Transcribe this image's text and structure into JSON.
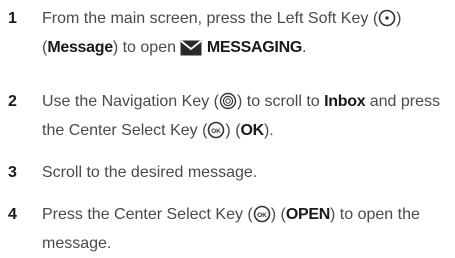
{
  "steps": [
    {
      "number": "1",
      "text_a": "From the main screen, press the Left Soft Key (",
      "text_b": ") (",
      "bold_1": "Message",
      "text_c": ") to open",
      "bold_2": "MESSAGING",
      "text_d": "."
    },
    {
      "number": "2",
      "text_a": "Use the Navigation Key (",
      "text_b": ") to scroll to",
      "bold_1": "Inbox",
      "text_c": "and press the Center Select Key (",
      "text_d": ") (",
      "bold_2": "OK",
      "text_e": ")."
    },
    {
      "number": "3",
      "text_a": "Scroll to the desired message."
    },
    {
      "number": "4",
      "text_a": "Press the Center Select Key (",
      "text_b": ") (",
      "bold_1": "OPEN",
      "text_c": ") to open the message."
    }
  ],
  "icons": {
    "left_soft_key": "soft-key-icon",
    "messaging": "envelope-icon",
    "navigation_key": "navigation-key-icon",
    "center_select": "ok-key-icon"
  },
  "colors": {
    "body_text": "#4a4a4a",
    "bold_text": "#1a1a1a"
  }
}
